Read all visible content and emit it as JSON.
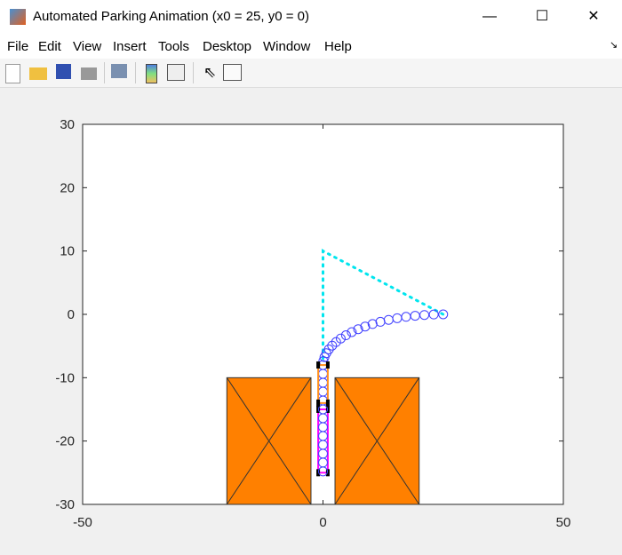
{
  "window": {
    "title": "Automated Parking Animation (x0 = 25, y0 = 0)",
    "minimize": "—",
    "maximize": "☐",
    "close": "✕"
  },
  "menu": [
    "File",
    "Edit",
    "View",
    "Insert",
    "Tools",
    "Desktop",
    "Window",
    "Help"
  ],
  "toolbar": [
    "new-file-icon",
    "open-folder-icon",
    "save-icon",
    "print-icon",
    "link-plot-icon",
    "colorbar-icon",
    "legend-icon",
    "pointer-icon",
    "property-inspector-icon"
  ],
  "chart_data": {
    "type": "scatter",
    "xlim": [
      -50,
      50
    ],
    "ylim": [
      -30,
      30
    ],
    "xticks": [
      "-50",
      "0",
      "50"
    ],
    "yticks": [
      "30",
      "20",
      "10",
      "0",
      "-10",
      "-20",
      "-30"
    ],
    "xtick_values": [
      -50,
      0,
      50
    ],
    "ytick_values": [
      30,
      20,
      10,
      0,
      -10,
      -20,
      -30
    ],
    "colors": {
      "trajectory": "#4040ff",
      "reference": "#00e5ee",
      "obstacle": "#ff8000",
      "car_front": "#ff9020",
      "car_rear": "#ff00ff"
    },
    "obstacles": [
      {
        "x": [
          -20,
          -2.5
        ],
        "y": [
          -30,
          -10
        ]
      },
      {
        "x": [
          2.5,
          20
        ],
        "y": [
          -30,
          -10
        ]
      }
    ],
    "reference_path": {
      "x": [
        0,
        0,
        25
      ],
      "y": [
        -7,
        10,
        0
      ]
    },
    "trajectory": {
      "x": [
        25,
        23.04,
        21.09,
        19.17,
        17.28,
        15.43,
        13.65,
        11.94,
        10.31,
        8.77,
        7.32,
        5.99,
        4.78,
        3.69,
        2.73,
        1.9,
        1.22,
        0.69,
        0.31,
        0.08,
        0,
        0,
        0,
        0,
        0,
        0,
        0,
        0,
        0,
        0,
        0,
        0,
        0
      ],
      "y": [
        0,
        -0.02,
        -0.1,
        -0.22,
        -0.39,
        -0.61,
        -0.87,
        -1.18,
        -1.53,
        -1.92,
        -2.34,
        -2.8,
        -3.3,
        -3.82,
        -4.37,
        -4.94,
        -5.53,
        -6.13,
        -6.75,
        -7.37,
        -8,
        -9.4,
        -10.8,
        -12.2,
        -13.6,
        -15,
        -16.4,
        -17.8,
        -19.2,
        -20.6,
        -22,
        -23.4,
        -24.8
      ]
    },
    "car_front": {
      "x": [
        -1,
        1
      ],
      "y": [
        -14,
        -8
      ]
    },
    "car_rear": {
      "x": [
        -1,
        1
      ],
      "y": [
        -25,
        -15
      ]
    }
  }
}
